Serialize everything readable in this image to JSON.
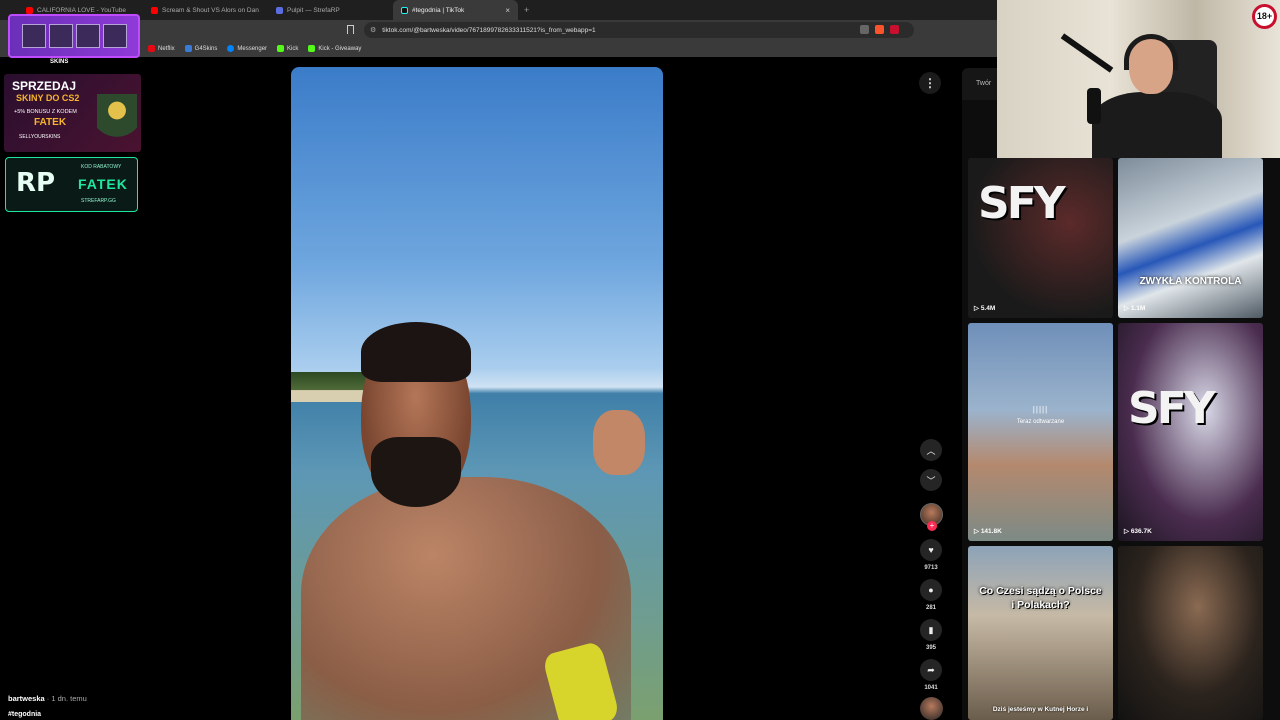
{
  "browser": {
    "tabs": [
      {
        "label": "CALIFORNIA LOVE - YouTube",
        "color": "#ff0000"
      },
      {
        "label": "Scream & Shout VS Alors on Dan",
        "color": "#ff0000"
      },
      {
        "label": "Pulpit — StrefaRP",
        "color": "#5b6ee1"
      }
    ],
    "active_tab": {
      "label": "#tegodnia | TikTok",
      "close": "×"
    },
    "new_tab": "+",
    "url": "tiktok.com/@bartweska/video/7671899782633311521?is_from_webapp=1",
    "bookmarks": [
      {
        "label": "Netflix",
        "color": "#e50914"
      },
      {
        "label": "G4Skins",
        "color": "#3a7bd5"
      },
      {
        "label": "Messenger",
        "color": "#0084ff"
      },
      {
        "label": "Kick",
        "color": "#53fc18"
      },
      {
        "label": "Kick - Giveaway",
        "color": "#53fc18"
      }
    ]
  },
  "overlay": {
    "brand": "SKINS",
    "ad_cs2": {
      "line1": "SPRZEDAJ",
      "line2": "SKINY DO CS2",
      "line3": "+5% BONUSU Z KODEM",
      "code": "FATEK",
      "footer": "SELLYOURSKINS"
    },
    "ad_fatek": {
      "logo": "RP",
      "line1": "KOD RABATOWY",
      "code": "FATEK",
      "site": "STREFARP.GG"
    },
    "badge": "18+"
  },
  "video": {
    "author": "bartweska",
    "ago": "· 1 dn. temu",
    "hashtag": "#tegodnia",
    "more_icon": "⋮",
    "likes": "9713",
    "comments": "281",
    "saves": "395",
    "shares": "1041"
  },
  "panel": {
    "tab_label": "Twór",
    "thumbs": [
      {
        "title": "SFY",
        "views": "5.4M"
      },
      {
        "title": "ZWYKŁA KONTROLA",
        "views": "1.1M"
      },
      {
        "title": "Teraz odtwarzane",
        "views": "141.8K"
      },
      {
        "title": "SFY",
        "views": "636.7K"
      },
      {
        "title": "Co Czesi sądzą o Polsce i Polakach?",
        "caption": "Dziś jesteśmy w Kutnej Horze i"
      },
      {
        "title": ""
      }
    ]
  }
}
